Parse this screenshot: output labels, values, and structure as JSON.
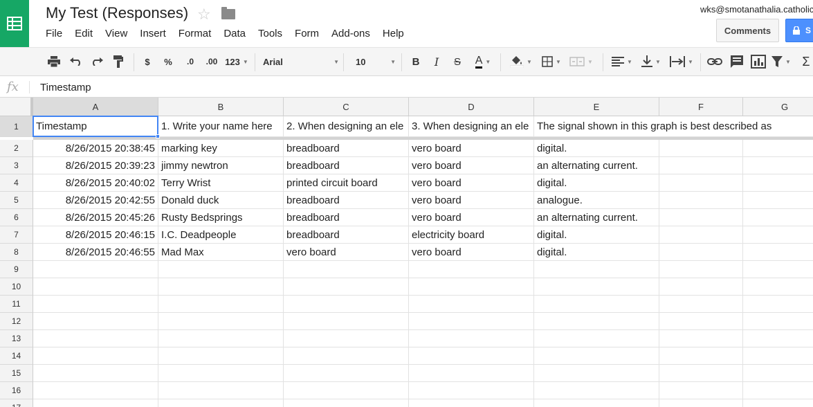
{
  "app": {
    "title": "My Test (Responses)",
    "user_email": "wks@smotanathalia.catholic",
    "comments_label": "Comments",
    "share_label": "S"
  },
  "menu": [
    "File",
    "Edit",
    "View",
    "Insert",
    "Format",
    "Data",
    "Tools",
    "Form",
    "Add-ons",
    "Help"
  ],
  "toolbar": {
    "currency": "$",
    "percent": "%",
    "dec_less": ".0",
    "dec_more": ".00",
    "number_format": "123",
    "font": "Arial",
    "font_size": "10",
    "bold": "B",
    "italic": "I",
    "strike": "S",
    "text_color": "A"
  },
  "formula_bar": {
    "fx": "fx",
    "value": "Timestamp"
  },
  "columns": [
    "A",
    "B",
    "C",
    "D",
    "E",
    "F",
    "G"
  ],
  "rows": [
    "1",
    "2",
    "3",
    "4",
    "5",
    "6",
    "7",
    "8",
    "9",
    "10",
    "11",
    "12",
    "13",
    "14",
    "15",
    "16",
    "17"
  ],
  "header_row": [
    "Timestamp",
    "1. Write your name here",
    "2. When designing an ele",
    "3. When designing an ele",
    "The signal shown in this graph is best described as"
  ],
  "data_rows": [
    [
      "8/26/2015 20:38:45",
      "marking key",
      "breadboard",
      "vero board",
      "digital."
    ],
    [
      "8/26/2015 20:39:23",
      "jimmy newtron",
      "breadboard",
      "vero board",
      "an alternating current."
    ],
    [
      "8/26/2015 20:40:02",
      "Terry Wrist",
      "printed circuit board",
      "vero board",
      "digital."
    ],
    [
      "8/26/2015 20:42:55",
      "Donald duck",
      "breadboard",
      "vero board",
      "analogue."
    ],
    [
      "8/26/2015 20:45:26",
      "Rusty Bedsprings",
      "breadboard",
      "vero board",
      "an alternating current."
    ],
    [
      "8/26/2015 20:46:15",
      "I.C. Deadpeople",
      "breadboard",
      "electricity board",
      "digital."
    ],
    [
      "8/26/2015 20:46:55",
      "Mad Max",
      "vero board",
      "vero board",
      "digital."
    ]
  ],
  "colors": {
    "brand": "#16a765",
    "selection": "#4285f4",
    "share": "#4d90fe"
  }
}
